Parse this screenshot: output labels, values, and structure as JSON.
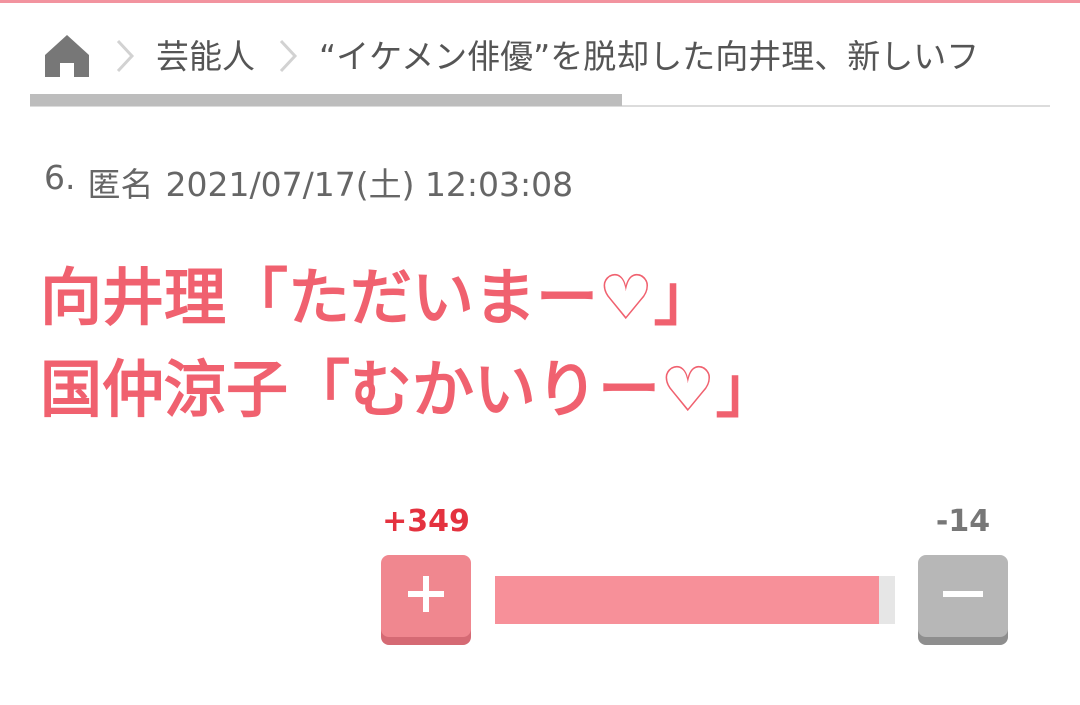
{
  "breadcrumb": {
    "home_icon": "home-icon",
    "category": "芸能人",
    "current": "“イケメン俳優”を脱却した向井理、新しいフ"
  },
  "reading_progress": 0.58,
  "post": {
    "number": "6.",
    "author": "匿名",
    "datetime": "2021/07/17(土) 12:03:08",
    "lines": [
      "向井理「ただいまー♡」",
      "国仲涼子「むかいりー♡」"
    ]
  },
  "votes": {
    "plus_count": "+349",
    "minus_count": "-14",
    "plus_icon": "plus-icon",
    "minus_icon": "minus-icon",
    "plus_share": 0.961
  },
  "colors": {
    "accent": "#f0616f",
    "plus_count": "#e4323f",
    "plus_button": "#f0878f",
    "minus_button": "#b7b7b7",
    "ratio_fill": "#f79099"
  }
}
